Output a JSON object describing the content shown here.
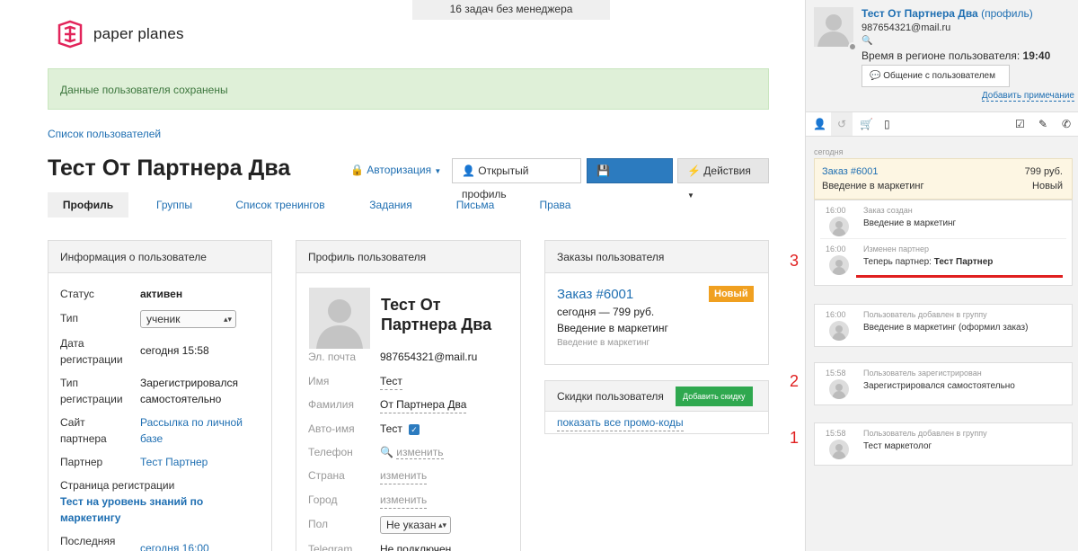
{
  "topbar": {
    "text": "16 задач без менеджера"
  },
  "logo": {
    "text": "paper planes"
  },
  "alert": {
    "text": "Данные пользователя сохранены"
  },
  "breadcrumb": {
    "text": "Список пользователей"
  },
  "title": "Тест От Партнера Два",
  "auth_label": "Авторизация",
  "buttons": {
    "open_profile": "Открытый профиль",
    "save": "Сохранить",
    "actions": "Действия"
  },
  "tabs": [
    "Профиль",
    "Группы",
    "Список тренингов",
    "Задания",
    "Письма",
    "Права"
  ],
  "info": {
    "head": "Информация о пользователе",
    "status_label": "Статус",
    "status_value": "активен",
    "type_label": "Тип",
    "type_value": "ученик",
    "regdate_label1": "Дата",
    "regdate_label2": "регистрации",
    "regdate_value": "сегодня 15:58",
    "regtype_label1": "Тип",
    "regtype_label2": "регистрации",
    "regtype_value1": "Зарегистрировался",
    "regtype_value2": "самостоятельно",
    "site_label1": "Сайт",
    "site_label2": "партнера",
    "site_value1": "Рассылка по личной",
    "site_value2": "базе",
    "partner_label": "Партнер",
    "partner_value": "Тест Партнер",
    "regpage_label": "Страница регистрации",
    "regpage_value1": "Тест на уровень знаний по",
    "regpage_value2": "маркетингу",
    "last_label": "Последняя",
    "last_value": "сегодня 16:00"
  },
  "profile": {
    "head": "Профиль пользователя",
    "name1": "Тест От",
    "name2": "Партнера Два",
    "email_label": "Эл. почта",
    "email_value": "987654321@mail.ru",
    "first_label": "Имя",
    "first_value": "Тест",
    "last_label": "Фамилия",
    "last_value": "От Партнера Два",
    "autoname_label": "Авто-имя",
    "autoname_value": "Тест",
    "phone_label": "Телефон",
    "phone_value": "изменить",
    "country_label": "Страна",
    "country_value": "изменить",
    "city_label": "Город",
    "city_value": "изменить",
    "gender_label": "Пол",
    "gender_value": "Не указан",
    "telegram_label": "Telegram",
    "telegram_value": "Не подключен"
  },
  "orders": {
    "head": "Заказы пользователя",
    "order_link": "Заказ #6001",
    "badge": "Новый",
    "line1": "сегодня — 799 руб.",
    "line2": "Введение в маркетинг",
    "line3": "Введение в маркетинг"
  },
  "discounts": {
    "head": "Скидки пользователя",
    "add": "Добавить скидку",
    "link": "показать все промо-коды"
  },
  "sidebar": {
    "name": "Тест От Партнера Два",
    "profile_link": "(профиль)",
    "email": "987654321@mail.ru",
    "region_time_label": "Время в регионе пользователя:",
    "region_time": "19:40",
    "chat_button": "Общение с пользователем",
    "add_note": "Добавить примечание",
    "today": "сегодня",
    "order": {
      "title": "Заказ #6001",
      "sum": "799 руб.",
      "product": "Введение в маркетинг",
      "status": "Новый"
    },
    "events": [
      {
        "time": "16:00",
        "title": "Заказ создан",
        "text": "Введение в маркетинг"
      },
      {
        "time": "16:00",
        "title": "Изменен партнер",
        "text_prefix": "Теперь партнер:",
        "text_bold": "Тест Партнер"
      },
      {
        "time": "16:00",
        "title": "Пользователь добавлен в группу",
        "text": "Введение в маркетинг (оформил заказ)"
      },
      {
        "time": "15:58",
        "title": "Пользователь зарегистрирован",
        "text": "Зарегистрировался самостоятельно"
      },
      {
        "time": "15:58",
        "title": "Пользователь добавлен в группу",
        "text": "Тест маркетолог"
      }
    ],
    "markers": [
      "3",
      "2",
      "1"
    ]
  },
  "colors": {
    "accent": "#2c7bbf",
    "success_bg": "#dff0d8",
    "badge": "#f0a020",
    "green": "#2fa84f",
    "annotation": "#e02020"
  }
}
